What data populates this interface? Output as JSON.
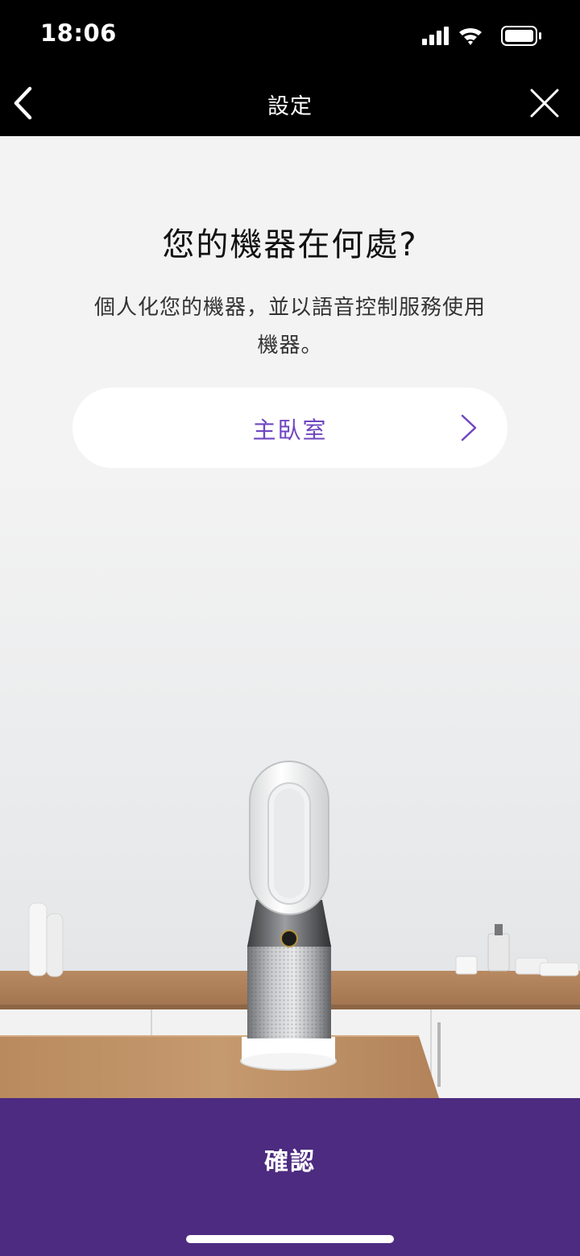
{
  "status_bar": {
    "time": "18:06",
    "icons": [
      "signal-icon",
      "wifi-icon",
      "battery-icon"
    ]
  },
  "nav": {
    "title": "設定",
    "back_icon": "chevron-left-icon",
    "close_icon": "close-icon"
  },
  "main": {
    "heading": "您的機器在何處?",
    "subtext_line1": "個人化您的機器，並以語音控制服務使用",
    "subtext_line2": "機器。",
    "location": {
      "value": "主臥室",
      "icon": "chevron-right-icon"
    }
  },
  "footer": {
    "confirm_label": "確認"
  },
  "colors": {
    "accent": "#6f46c0",
    "confirm_bg": "#4c2b80",
    "header_bg": "#000000"
  }
}
